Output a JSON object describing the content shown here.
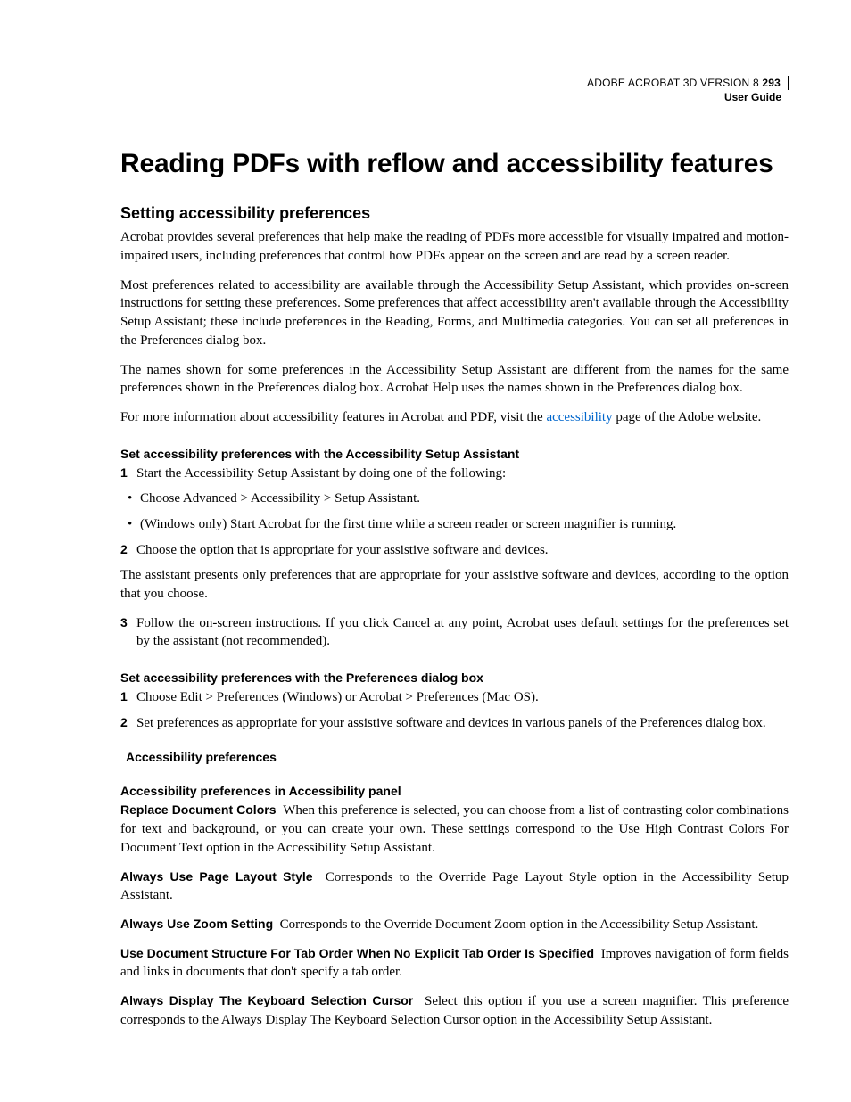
{
  "header": {
    "product": "ADOBE ACROBAT 3D VERSION 8",
    "page_number": "293",
    "subtitle": "User Guide"
  },
  "title": "Reading PDFs with reflow and accessibility features",
  "section_heading": "Setting accessibility preferences",
  "intro_p1": "Acrobat provides several preferences that help make the reading of PDFs more accessible for visually impaired and motion-impaired users, including preferences that control how PDFs appear on the screen and are read by a screen reader.",
  "intro_p2": "Most preferences related to accessibility are available through the Accessibility Setup Assistant, which provides on-screen instructions for setting these preferences. Some preferences that affect accessibility aren't available through the Accessibility Setup Assistant; these include preferences in the Reading, Forms, and Multimedia categories. You can set all preferences in the Preferences dialog box.",
  "intro_p3": "The names shown for some preferences in the Accessibility Setup Assistant are different from the names for the same preferences shown in the Preferences dialog box. Acrobat Help uses the names shown in the Preferences dialog box.",
  "intro_p4_a": "For more information about accessibility features in Acrobat and PDF, visit the ",
  "intro_p4_link": "accessibility",
  "intro_p4_b": " page of the Adobe website.",
  "sub1_heading": "Set accessibility preferences with the Accessibility Setup Assistant",
  "sub1_step1": "Start the Accessibility Setup Assistant by doing one of the following:",
  "sub1_bullet1": "Choose Advanced > Accessibility > Setup Assistant.",
  "sub1_bullet2": "(Windows only) Start Acrobat for the first time while a screen reader or screen magnifier is running.",
  "sub1_step2": "Choose the option that is appropriate for your assistive software and devices.",
  "sub1_after": "The assistant presents only preferences that are appropriate for your assistive software and devices, according to the option that you choose.",
  "sub1_step3": "Follow the on-screen instructions. If you click Cancel at any point, Acrobat uses default settings for the preferences set by the assistant (not recommended).",
  "sub2_heading": "Set accessibility preferences with the Preferences dialog box",
  "sub2_step1": "Choose Edit > Preferences (Windows) or Acrobat > Preferences (Mac OS).",
  "sub2_step2": "Set preferences as appropriate for your assistive software and devices in various panels of the Preferences dialog box.",
  "prefs_heading": "Accessibility preferences",
  "panel_heading": "Accessibility preferences in Accessibility panel",
  "items": {
    "replace_colors": {
      "label": "Replace Document Colors",
      "text": "When this preference is selected, you can choose from a list of contrasting color combinations for text and background, or you can create your own. These settings correspond to the Use High Contrast Colors For Document Text option in the Accessibility Setup Assistant."
    },
    "page_layout": {
      "label": "Always Use Page Layout Style",
      "text": "Corresponds to the Override Page Layout Style option in the Accessibility Setup Assistant."
    },
    "zoom": {
      "label": "Always Use Zoom Setting",
      "text": "Corresponds to the Override Document Zoom option in the Accessibility Setup Assistant."
    },
    "tab_order": {
      "label": "Use Document Structure For Tab Order When No Explicit Tab Order Is Specified",
      "text": "Improves navigation of form fields and links in documents that don't specify a tab order."
    },
    "cursor": {
      "label": "Always Display The Keyboard Selection Cursor",
      "text": "Select this option if you use a screen magnifier. This preference corresponds to the Always Display The Keyboard Selection Cursor option in the Accessibility Setup Assistant."
    }
  }
}
